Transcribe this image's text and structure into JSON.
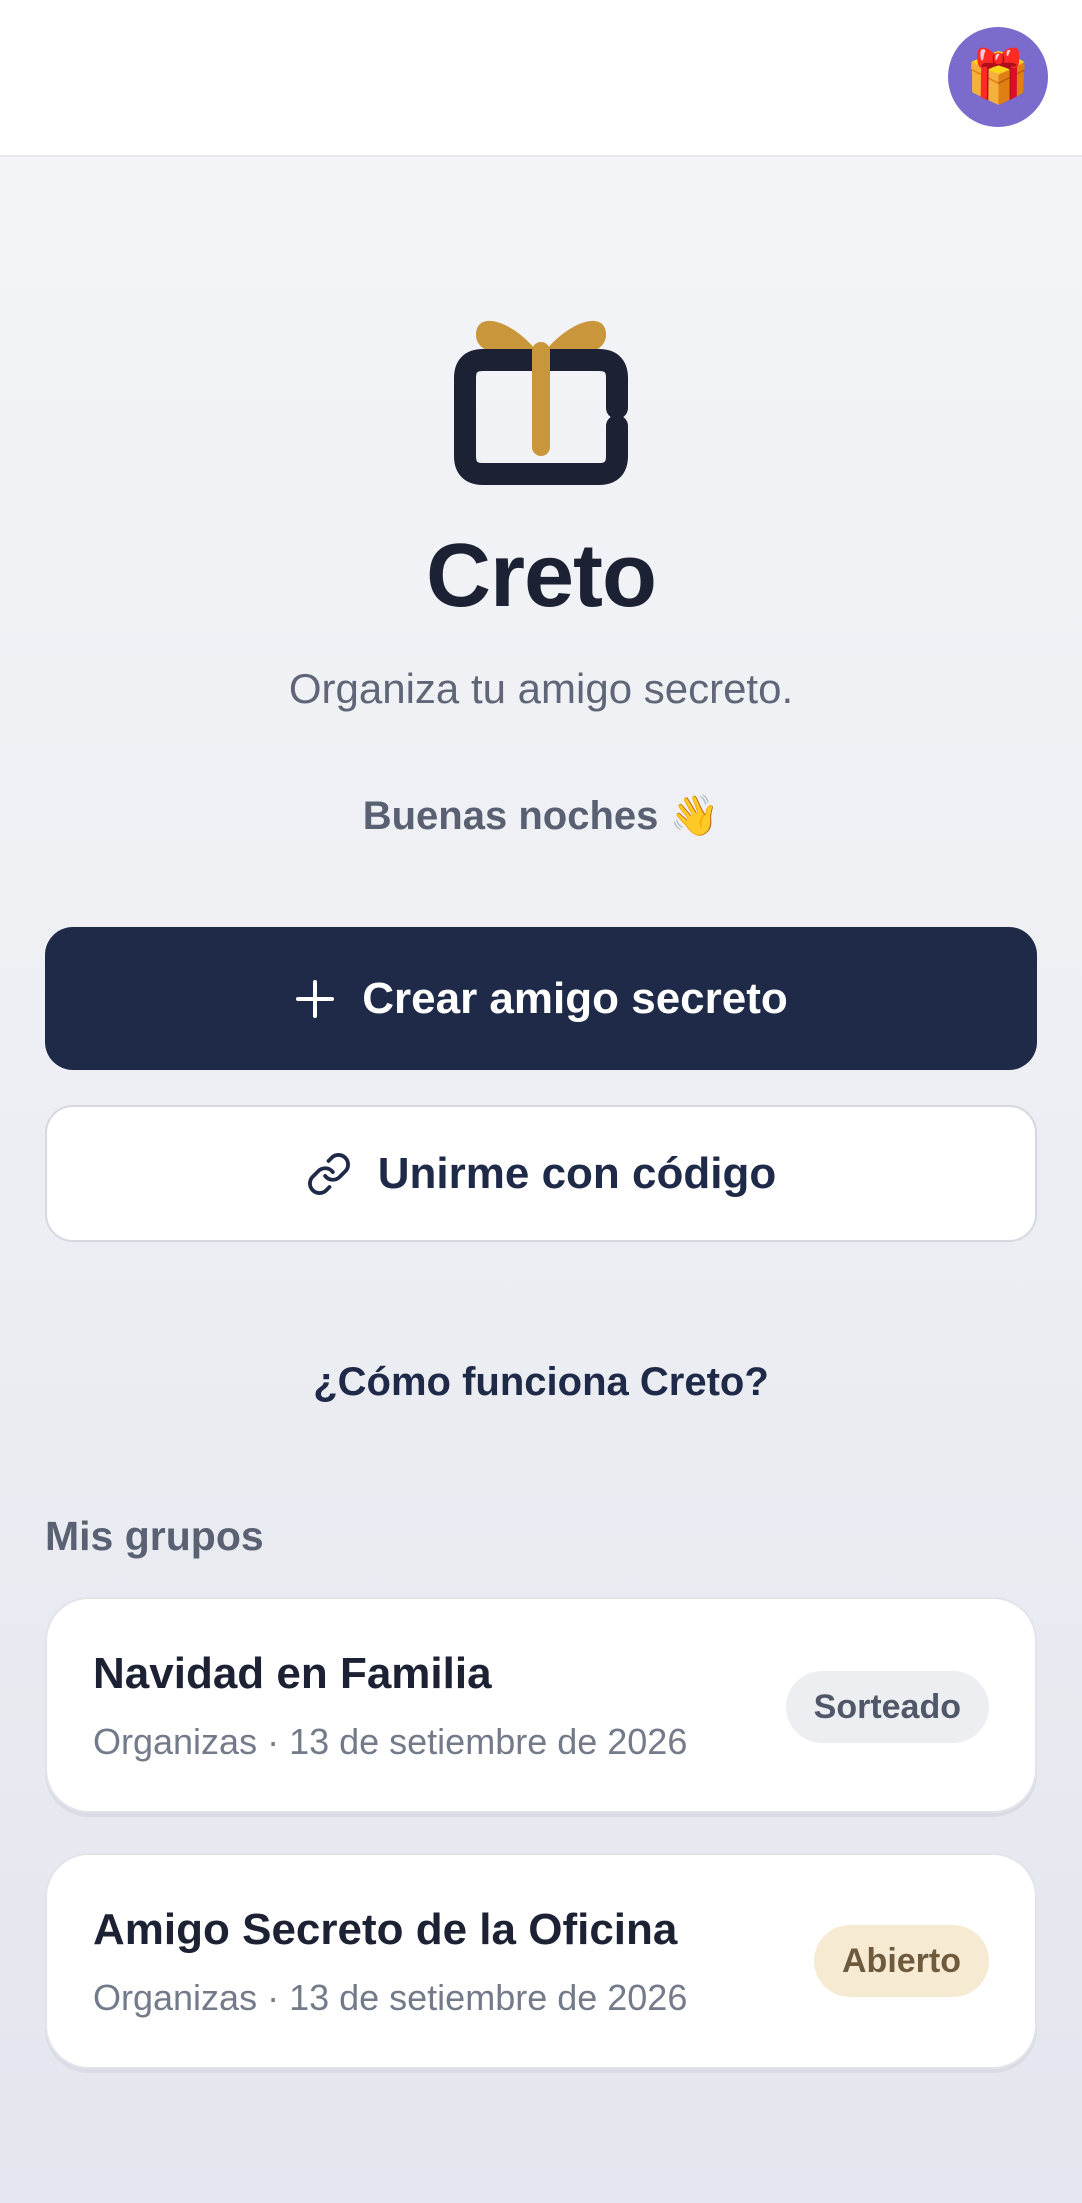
{
  "header": {
    "avatar_emoji": "🎁",
    "avatar_color": "#7b6bcc"
  },
  "hero": {
    "logo_icon": "gift-icon",
    "title": "Creto",
    "subtitle": "Organiza tu amigo secreto.",
    "greeting": "Buenas noches 👋"
  },
  "actions": {
    "create_label": "Crear amigo secreto",
    "create_icon": "plus-icon",
    "join_label": "Unirme con código",
    "join_icon": "link-icon",
    "how_label": "¿Cómo funciona Creto?"
  },
  "groups": {
    "section_title": "Mis grupos",
    "items": [
      {
        "name": "Navidad en Familia",
        "meta": "Organizas · 13 de setiembre de 2026",
        "status": "Sorteado"
      },
      {
        "name": "Amigo Secreto de la Oficina",
        "meta": "Organizas · 13 de setiembre de 2026",
        "status": "Abierto"
      }
    ]
  },
  "colors": {
    "primary": "#1f2a48",
    "accent_gold": "#c9963c",
    "badge_open_bg": "#f6ead2",
    "badge_drawn_bg": "#eceef2"
  }
}
